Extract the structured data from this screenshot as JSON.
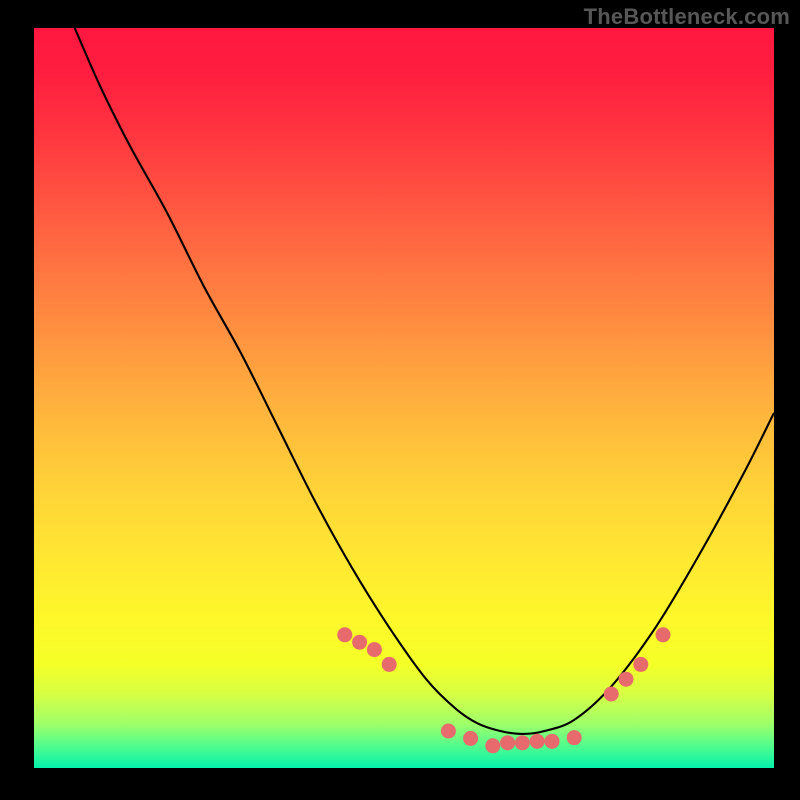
{
  "watermark": "TheBottleneck.com",
  "chart_data": {
    "type": "line",
    "title": "",
    "xlabel": "",
    "ylabel": "",
    "xlim": [
      0,
      100
    ],
    "ylim": [
      0,
      100
    ],
    "series": [
      {
        "name": "bottleneck-curve",
        "x": [
          5.5,
          9,
          13,
          18,
          23,
          28,
          33,
          38,
          43,
          48,
          53,
          57,
          60,
          63,
          66,
          69,
          73,
          78,
          84,
          90,
          96,
          100
        ],
        "y": [
          100,
          92,
          84,
          75,
          65,
          56,
          46,
          36,
          27,
          19,
          12,
          8,
          6,
          5,
          4.6,
          5,
          6.5,
          11,
          19,
          29,
          40,
          48
        ]
      }
    ],
    "markers": {
      "name": "highlighted-points",
      "x": [
        42,
        44,
        46,
        48,
        56,
        59,
        62,
        64,
        66,
        68,
        70,
        73,
        78,
        80,
        82,
        85
      ],
      "y": [
        18,
        17,
        16,
        14,
        5,
        4,
        3,
        3.4,
        3.4,
        3.6,
        3.6,
        4.1,
        10,
        12,
        14,
        18
      ]
    }
  }
}
